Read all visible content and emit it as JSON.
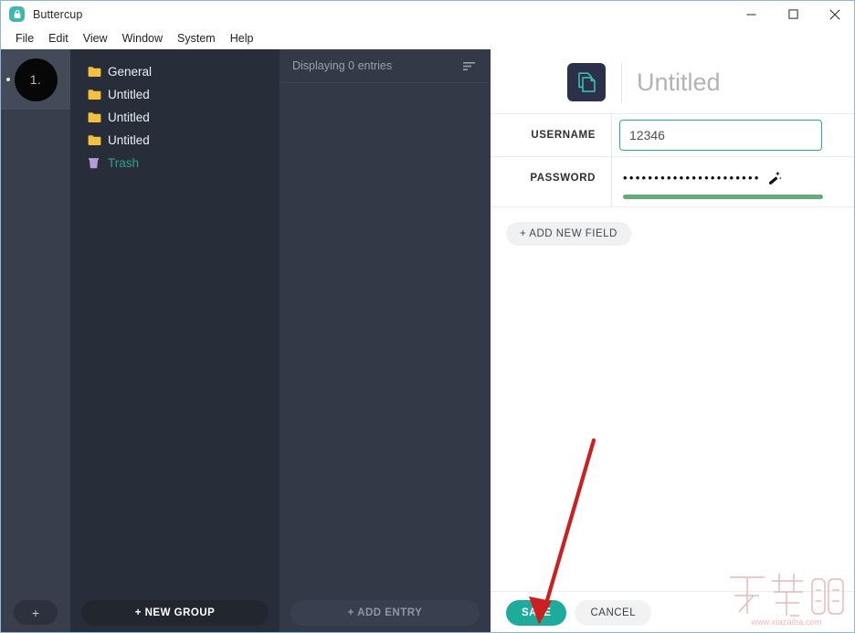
{
  "window": {
    "title": "Buttercup",
    "app_icon": "lock-icon",
    "controls": {
      "minimize": "minimize-icon",
      "maximize": "maximize-icon",
      "close": "close-icon"
    }
  },
  "menubar": {
    "items": [
      {
        "label": "File"
      },
      {
        "label": "Edit"
      },
      {
        "label": "View"
      },
      {
        "label": "Window"
      },
      {
        "label": "System"
      },
      {
        "label": "Help"
      }
    ]
  },
  "rail": {
    "vaults": [
      {
        "label": "1.",
        "active": true
      }
    ],
    "add_vault_label": "+"
  },
  "groups": {
    "items": [
      {
        "label": "General",
        "icon": "folder-icon",
        "type": "folder"
      },
      {
        "label": "Untitled",
        "icon": "folder-icon",
        "type": "folder"
      },
      {
        "label": "Untitled",
        "icon": "folder-icon",
        "type": "folder"
      },
      {
        "label": "Untitled",
        "icon": "folder-icon",
        "type": "folder"
      },
      {
        "label": "Trash",
        "icon": "trash-icon",
        "type": "trash"
      }
    ],
    "new_group_label": "+ NEW GROUP"
  },
  "entries": {
    "count_text": "Displaying 0 entries",
    "sort_icon": "sort-icon",
    "add_entry_label": "+ ADD ENTRY",
    "list": []
  },
  "detail": {
    "entry_icon": "documents-icon",
    "title": "Untitled",
    "fields": [
      {
        "label": "USERNAME",
        "value": "12346",
        "type": "text",
        "focused": true
      },
      {
        "label": "PASSWORD",
        "value": "••••••••••••••••••••••",
        "type": "password",
        "generator_icon": "magic-wand-icon",
        "strength_color": "#64ab77"
      }
    ],
    "add_field_label": "+ ADD NEW FIELD",
    "save_label": "SAVE",
    "cancel_label": "CANCEL"
  },
  "annotation": {
    "arrow_color": "#cc1f1f",
    "points_at": "save-button"
  },
  "watermark": {
    "glyphs": "下载吧",
    "url": "www.xiazaiba.com"
  },
  "colors": {
    "accent_teal": "#1fab9b",
    "rail_bg": "#383e4b",
    "groups_bg": "#282d3a",
    "entries_bg": "#333947",
    "folder_yellow": "#f3c13f",
    "trash_purple": "#b39ddb"
  }
}
